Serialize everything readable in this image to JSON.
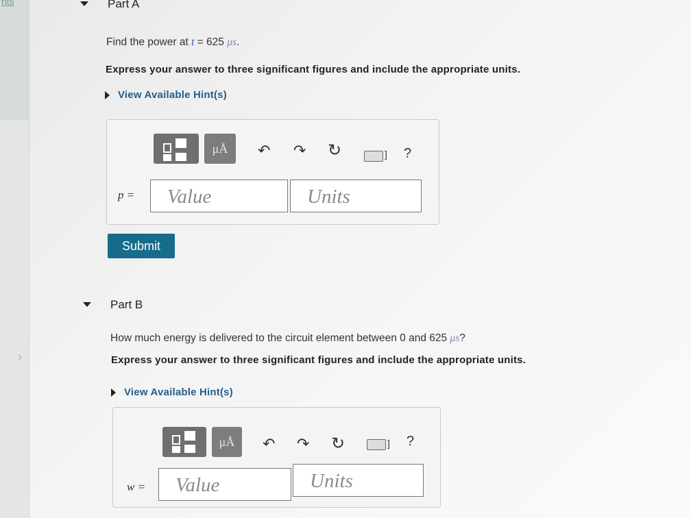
{
  "sidebar": {
    "tab_label": "nts",
    "chevron": "›"
  },
  "part_a": {
    "title": "Part A",
    "question_prefix": "Find the power at ",
    "question_var": "t",
    "question_mid": " = 625 ",
    "question_unit": "μs",
    "question_suffix": ".",
    "instructions": "Express your answer to three significant figures and include the appropriate units.",
    "hint_label": "View Available Hint(s)",
    "toolbar": {
      "units_symbol": "μÅ",
      "help_label": "?"
    },
    "var_label": "p =",
    "value_placeholder": "Value",
    "units_placeholder": "Units",
    "submit_label": "Submit"
  },
  "part_b": {
    "title": "Part B",
    "question_prefix": "How much energy is delivered to the circuit element between 0 and 625 ",
    "question_unit": "μs",
    "question_suffix": "?",
    "instructions": "Express your answer to three significant figures and include the appropriate units.",
    "hint_label": "View Available Hint(s)",
    "toolbar": {
      "units_symbol": "μÅ",
      "help_label": "?"
    },
    "var_label": "w =",
    "value_placeholder": "Value",
    "units_placeholder": "Units"
  },
  "colors": {
    "submit_bg": "#166c8a",
    "hint_text": "#235e8a",
    "toolbar_btn": "#6f6f6f"
  }
}
